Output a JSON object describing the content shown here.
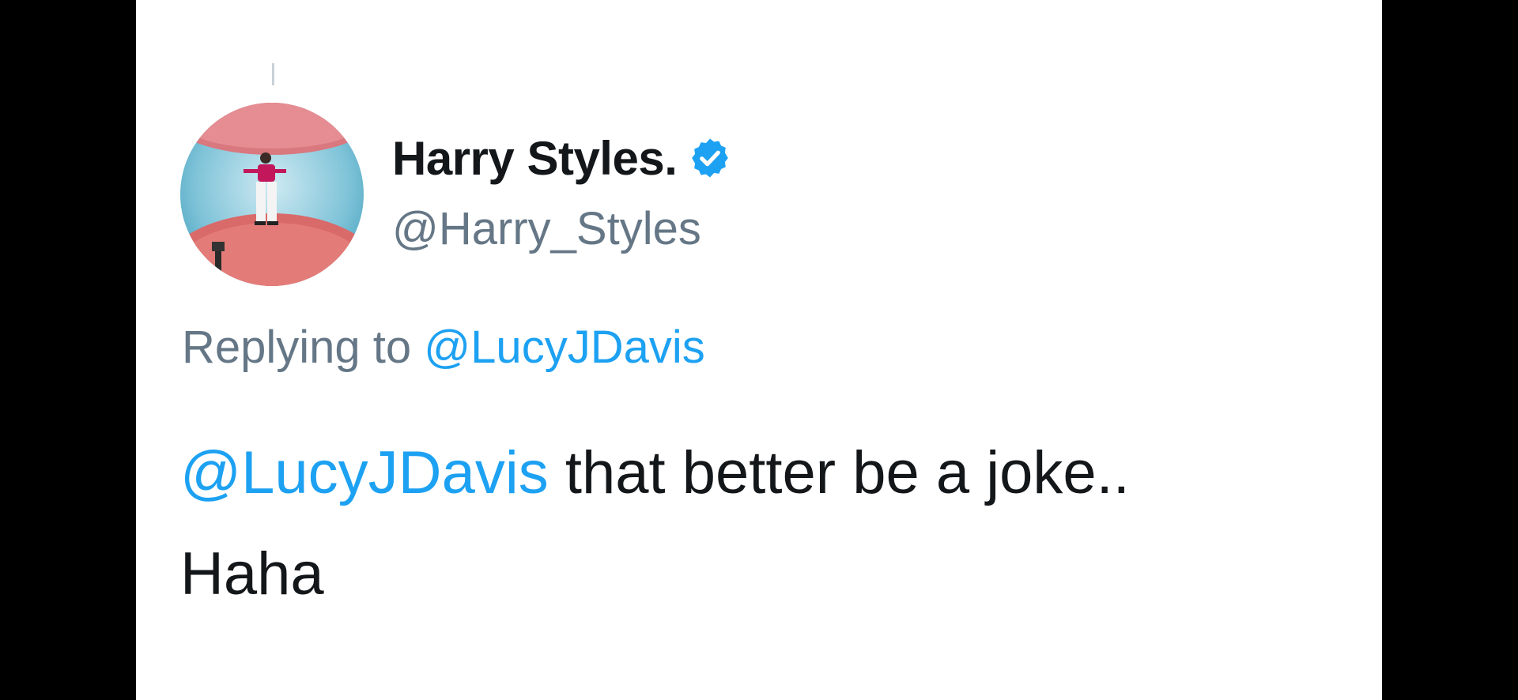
{
  "tweet": {
    "author": {
      "display_name": "Harry Styles.",
      "handle": "@Harry_Styles",
      "verified_icon": "verified-badge-icon"
    },
    "reply": {
      "prefix": "Replying to",
      "mention": "@LucyJDavis"
    },
    "body": {
      "mention": "@LucyJDavis",
      "line1_text": " that better be a joke..",
      "line2_text": "Haha"
    }
  },
  "colors": {
    "background": "#000000",
    "card": "#ffffff",
    "name": "#14171a",
    "secondary": "#657786",
    "link": "#1da1f2",
    "verified": "#1da1f2"
  }
}
